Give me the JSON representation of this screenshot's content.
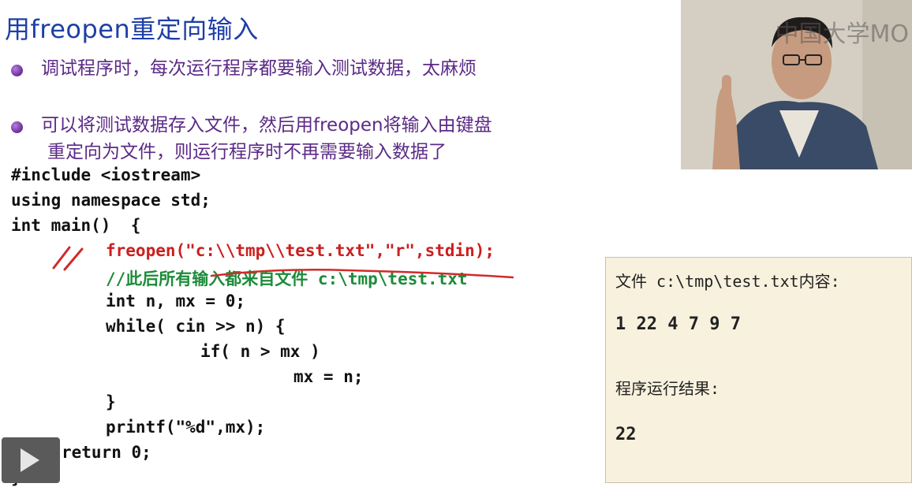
{
  "slide": {
    "title": "用freopen重定向输入",
    "bullets": [
      {
        "lines": [
          "调试程序时，每次运行程序都要输入测试数据，太麻烦"
        ]
      },
      {
        "lines": [
          "可以将测试数据存入文件，然后用freopen将输入由键盘",
          "重定向为文件，则运行程序时不再需要输入数据了"
        ]
      }
    ]
  },
  "code": {
    "lines": [
      "#include <iostream>",
      "using namespace std;",
      "int main()  {",
      "freopen(\"c:\\\\tmp\\\\test.txt\",\"r\",stdin);",
      "//此后所有输入都来自文件 c:\\tmp\\test.txt",
      "int n, mx = 0;",
      "while( cin >> n) {",
      "if( n > mx )",
      "mx = n;",
      "}",
      "printf(\"%d\",mx);",
      "return 0;",
      "}"
    ],
    "colors": {
      "highlight": "#cc1f1f",
      "comment": "#1c8c3a"
    }
  },
  "output_box": {
    "file_label": "文件 c:\\tmp\\test.txt内容:",
    "file_content": "1 22 4 7 9 7",
    "result_label": "程序运行结果:",
    "result_value": "22"
  },
  "video": {
    "watermark": "中国大学MO",
    "content": "presenter-video"
  },
  "player": {
    "play_icon": "play-icon"
  },
  "annotation": {
    "mark": "red hand-drawn slashes and underline",
    "color": "#d12a2a"
  }
}
